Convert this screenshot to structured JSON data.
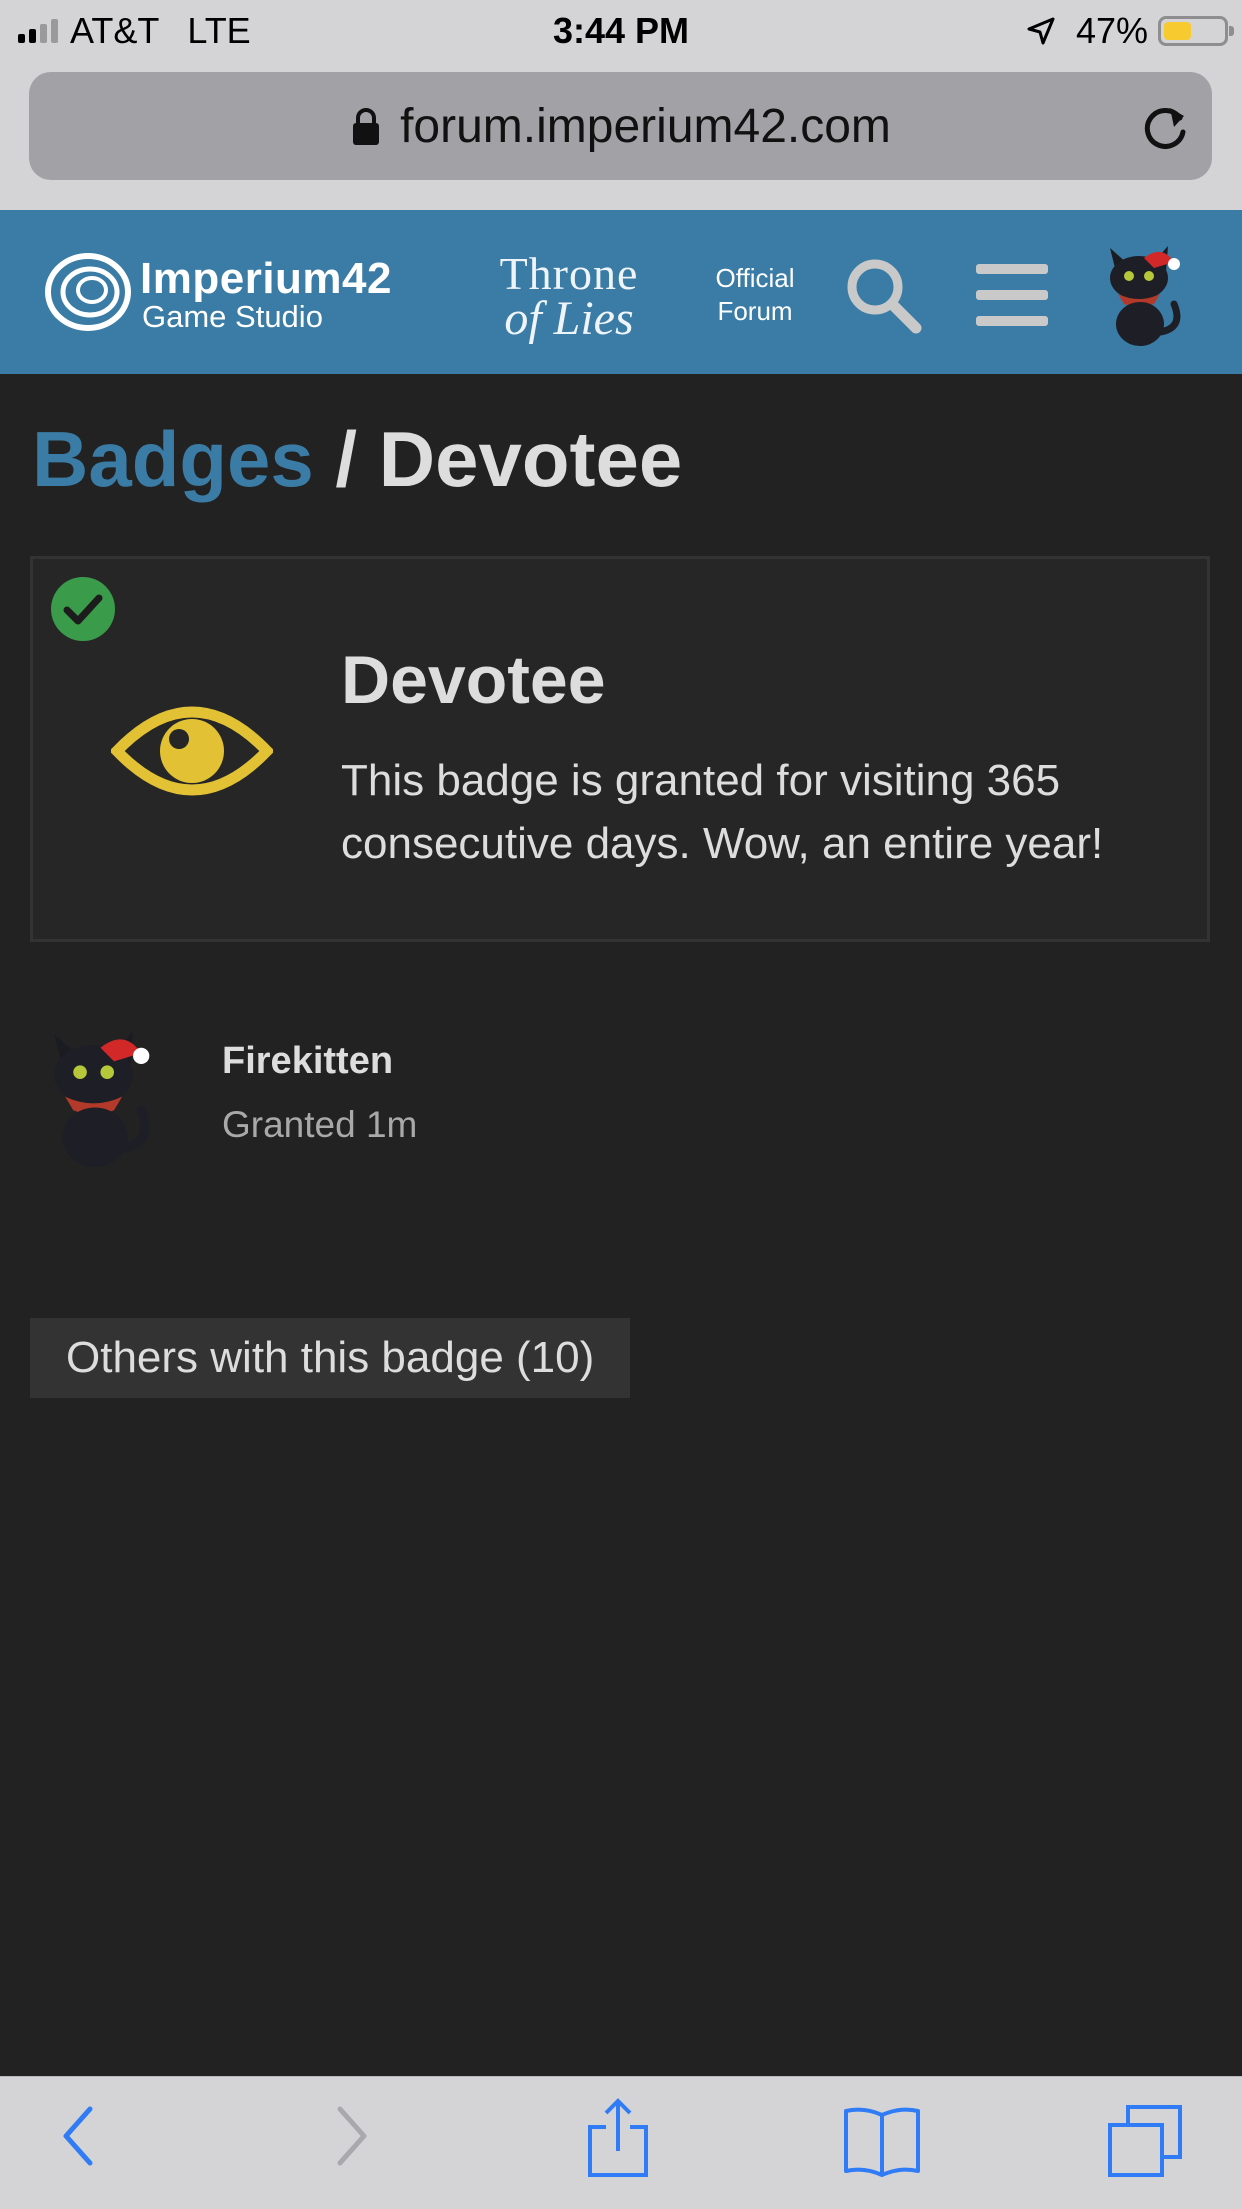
{
  "status_bar": {
    "carrier": "AT&T",
    "network": "LTE",
    "time": "3:44 PM",
    "battery_percent": "47%",
    "battery_level": 0.47,
    "signal_bars_active": 2,
    "signal_bars_total": 4
  },
  "browser": {
    "url": "forum.imperium42.com"
  },
  "header": {
    "studio_name": "Imperium42",
    "studio_sub": "Game Studio",
    "game_logo_line1": "Throne",
    "game_logo_line2": "of Lies",
    "official_line1": "Official",
    "official_line2": "Forum",
    "icons": [
      "search-icon",
      "hamburger-menu-icon",
      "user-avatar"
    ],
    "brand_color": "#3a7ca5"
  },
  "breadcrumb": {
    "parent": "Badges",
    "separator": " / ",
    "current": "Devotee"
  },
  "badge": {
    "title": "Devotee",
    "description": "This badge is granted for visiting 365 consecutive days. Wow, an entire year!",
    "icon": "eye-icon",
    "icon_color": "#e2c234",
    "granted_check_color": "#3a9b4b"
  },
  "grant": {
    "username": "Firekitten",
    "granted_text": "Granted 1m"
  },
  "others_button": "Others with this badge (10)",
  "toolbar": {
    "icons": [
      "back-icon",
      "forward-icon",
      "share-icon",
      "bookmarks-icon",
      "tabs-icon"
    ],
    "accent": "#2f7cf6"
  }
}
